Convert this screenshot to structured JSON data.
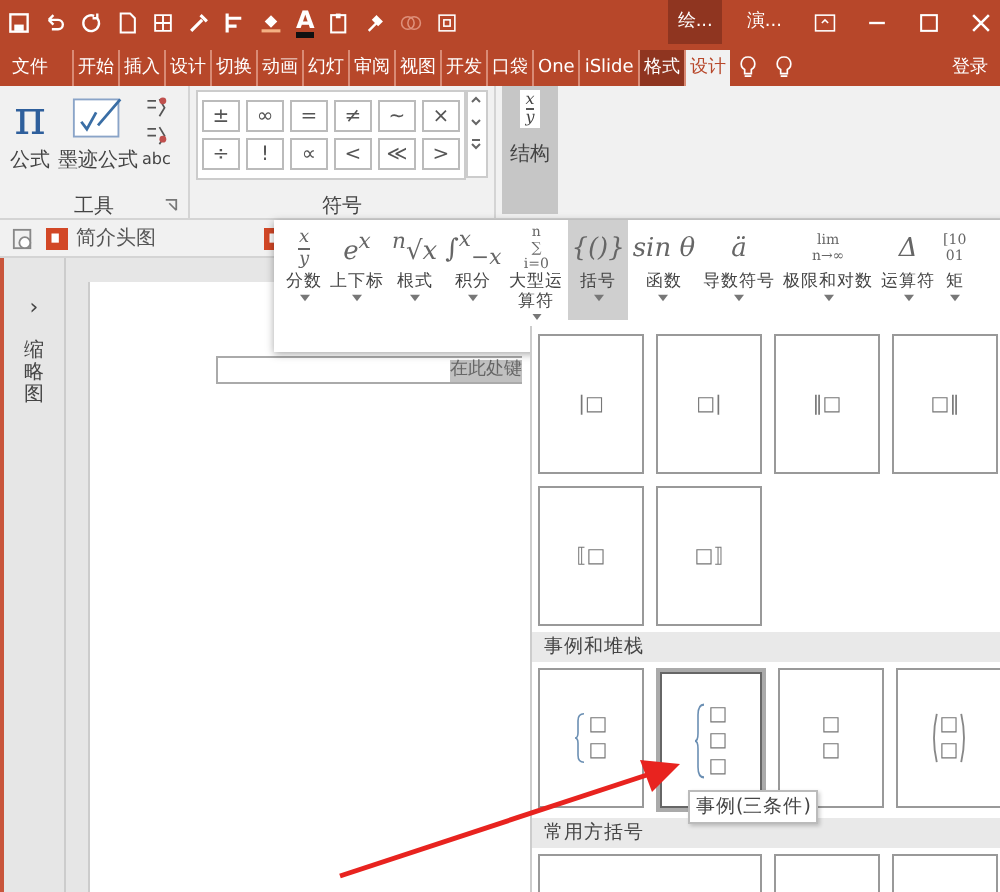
{
  "title_bar": {
    "font_color_letter": "A",
    "context_tabs": [
      {
        "label": "绘...",
        "selected": true
      },
      {
        "label": "演...",
        "selected": false
      }
    ]
  },
  "ribbon_tabs": [
    {
      "label": "文件",
      "selected": false
    },
    {
      "label": "开始",
      "selected": false
    },
    {
      "label": "插入",
      "selected": false
    },
    {
      "label": "设计",
      "selected": false
    },
    {
      "label": "切换",
      "selected": false
    },
    {
      "label": "动画",
      "selected": false
    },
    {
      "label": "幻灯",
      "selected": false
    },
    {
      "label": "审阅",
      "selected": false
    },
    {
      "label": "视图",
      "selected": false
    },
    {
      "label": "开发",
      "selected": false
    },
    {
      "label": "口袋",
      "selected": false
    },
    {
      "label": "One",
      "selected": false
    },
    {
      "label": "iSlide",
      "selected": false
    },
    {
      "label": "格式",
      "selected": false
    },
    {
      "label": "设计",
      "selected": true
    }
  ],
  "sign_in": "登录",
  "tools_group": {
    "label": "工具",
    "equation_button": {
      "glyph": "π",
      "label": "公式"
    },
    "ink_button": {
      "label": "墨迹公式"
    },
    "small_text": "abc"
  },
  "symbols_group": {
    "label": "符号",
    "symbols": [
      "±",
      "∞",
      "=",
      "≠",
      "~",
      "×",
      "÷",
      "!",
      "∝",
      "<",
      "≪",
      ">"
    ]
  },
  "structure_button": {
    "top": "x",
    "bottom": "y",
    "label": "结构",
    "selected": true
  },
  "document_tabs": [
    {
      "label": "简介头图"
    }
  ],
  "thumbnail_pane": {
    "expand": "›",
    "label": "缩略图"
  },
  "slide": {
    "placeholder_text": "在此处键"
  },
  "structures": [
    {
      "kind": "fraction",
      "glyph": [
        "x",
        "y"
      ],
      "label": "分数",
      "selected": false
    },
    {
      "kind": "plain",
      "glyph": [
        "e$^{x}$"
      ],
      "label": "上下标",
      "selected": false
    },
    {
      "kind": "plain",
      "glyph": [
        "$^{n}$√x"
      ],
      "label": "根式",
      "selected": false
    },
    {
      "kind": "plain",
      "glyph": [
        "∫$^{x}$$_{−x}$"
      ],
      "label": "积分",
      "selected": false
    },
    {
      "kind": "stack",
      "glyph": [
        "n",
        "∑",
        "i=0"
      ],
      "label": "大型运算符",
      "selected": false
    },
    {
      "kind": "plain",
      "glyph": [
        "{()}"
      ],
      "label": "括号",
      "selected": true
    },
    {
      "kind": "plain",
      "glyph": [
        "sin θ"
      ],
      "label": "函数",
      "selected": false
    },
    {
      "kind": "plain",
      "glyph": [
        "ä"
      ],
      "label": "导数符号",
      "selected": false
    },
    {
      "kind": "stack",
      "glyph": [
        "lim",
        "n→∞"
      ],
      "label": "极限和对数",
      "selected": false
    },
    {
      "kind": "plain",
      "glyph": [
        "Δ"
      ],
      "label": "运算符",
      "selected": false
    },
    {
      "kind": "stack",
      "glyph": [
        "[10",
        "01"
      ],
      "label": "矩",
      "selected": false
    }
  ],
  "gallery": [
    {
      "kind": "tiles",
      "tiles": [
        {
          "kind": "inline",
          "glyph": [
            "|□"
          ],
          "selected": false
        },
        {
          "kind": "inline",
          "glyph": [
            "□|"
          ],
          "selected": false
        },
        {
          "kind": "inline",
          "glyph": [
            "‖□"
          ],
          "selected": false
        },
        {
          "kind": "inline",
          "glyph": [
            "□‖"
          ],
          "selected": false
        },
        {
          "kind": "inline",
          "glyph": [
            "⟦□"
          ],
          "selected": false
        },
        {
          "kind": "inline",
          "glyph": [
            "□⟧"
          ],
          "selected": false
        }
      ]
    },
    {
      "kind": "header",
      "label": "事例和堆栈"
    },
    {
      "kind": "tiles",
      "tiles": [
        {
          "kind": "brace",
          "glyph": [
            "□",
            "□"
          ],
          "selected": false
        },
        {
          "kind": "brace",
          "glyph": [
            "□",
            "□",
            "□"
          ],
          "selected": true
        },
        {
          "kind": "stack",
          "glyph": [
            "□",
            "□"
          ],
          "selected": false
        },
        {
          "kind": "paren",
          "glyph": [
            "□",
            "□"
          ],
          "selected": false
        }
      ]
    },
    {
      "kind": "header",
      "label": "常用方括号"
    },
    {
      "kind": "tiles",
      "tiles": [
        {
          "kind": "wide",
          "selected": false
        },
        {
          "kind": "blank",
          "selected": false
        },
        {
          "kind": "blank",
          "selected": false
        }
      ]
    }
  ],
  "tooltip": "事例(三条件)"
}
